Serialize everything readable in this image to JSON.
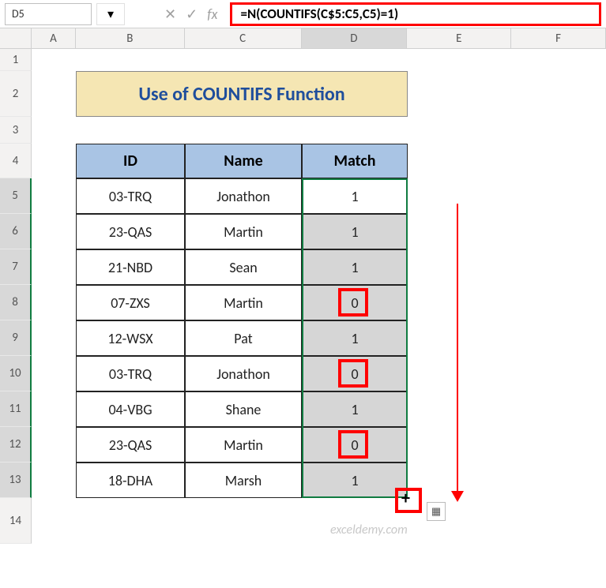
{
  "name_box": "D5",
  "formula": "=N(COUNTIFS(C$5:C5,C5)=1)",
  "columns": [
    "A",
    "B",
    "C",
    "D",
    "E",
    "F"
  ],
  "rows": [
    "1",
    "2",
    "3",
    "4",
    "5",
    "6",
    "7",
    "8",
    "9",
    "10",
    "11",
    "12",
    "13",
    "14"
  ],
  "title": "Use of COUNTIFS Function",
  "table": {
    "headers": [
      "ID",
      "Name",
      "Match"
    ],
    "rows": [
      {
        "id": "03-TRQ",
        "name": "Jonathon",
        "match": "1"
      },
      {
        "id": "23-QAS",
        "name": "Martin",
        "match": "1"
      },
      {
        "id": "21-NBD",
        "name": "Sean",
        "match": "1"
      },
      {
        "id": "07-ZXS",
        "name": "Martin",
        "match": "0"
      },
      {
        "id": "12-WSX",
        "name": "Pat",
        "match": "1"
      },
      {
        "id": "03-TRQ",
        "name": "Jonathon",
        "match": "0"
      },
      {
        "id": "04-VBG",
        "name": "Shane",
        "match": "1"
      },
      {
        "id": "23-QAS",
        "name": "Martin",
        "match": "0"
      },
      {
        "id": "18-DHA",
        "name": "Marsh",
        "match": "1"
      }
    ]
  },
  "watermark": "exceldemy.com",
  "colors": {
    "accent": "#107c41",
    "highlight_red": "#ff0000",
    "title_bg": "#f5e6b3",
    "header_bg": "#a9c4e4"
  }
}
